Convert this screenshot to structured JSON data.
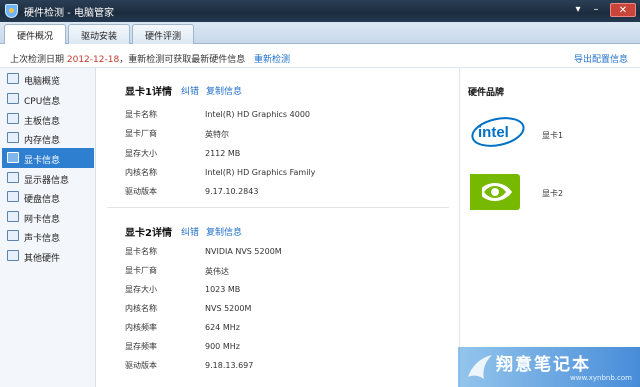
{
  "window": {
    "title": "硬件检测 - 电脑管家"
  },
  "tabs": [
    {
      "label": "硬件概况"
    },
    {
      "label": "驱动安装"
    },
    {
      "label": "硬件评测"
    }
  ],
  "infobar": {
    "prefix": "上次检测日期 ",
    "date": "2012-12-18",
    "suffix": "，重新检测可获取最新硬件信息",
    "recheck_label": "重新检测",
    "export_label": "导出配置信息"
  },
  "sidebar": {
    "items": [
      {
        "label": "电脑概览",
        "icon": "computer-icon"
      },
      {
        "label": "CPU信息",
        "icon": "cpu-icon"
      },
      {
        "label": "主板信息",
        "icon": "motherboard-icon"
      },
      {
        "label": "内存信息",
        "icon": "memory-icon"
      },
      {
        "label": "显卡信息",
        "icon": "graphics-card-icon"
      },
      {
        "label": "显示器信息",
        "icon": "monitor-icon"
      },
      {
        "label": "硬盘信息",
        "icon": "hard-disk-icon"
      },
      {
        "label": "网卡信息",
        "icon": "network-card-icon"
      },
      {
        "label": "声卡信息",
        "icon": "sound-card-icon"
      },
      {
        "label": "其他硬件",
        "icon": "other-hardware-icon"
      }
    ],
    "active_index": 4
  },
  "gpu1": {
    "title": "显卡1详情",
    "correct_label": "纠错",
    "copy_label": "复制信息",
    "rows": [
      {
        "label": "显卡名称",
        "value": "Intel(R) HD Graphics 4000"
      },
      {
        "label": "显卡厂商",
        "value": "英特尔"
      },
      {
        "label": "显存大小",
        "value": "2112 MB"
      },
      {
        "label": "内核名称",
        "value": "Intel(R) HD Graphics Family"
      },
      {
        "label": "驱动版本",
        "value": "9.17.10.2843"
      }
    ]
  },
  "gpu2": {
    "title": "显卡2详情",
    "correct_label": "纠错",
    "copy_label": "复制信息",
    "rows": [
      {
        "label": "显卡名称",
        "value": "NVIDIA NVS 5200M"
      },
      {
        "label": "显卡厂商",
        "value": "英伟达"
      },
      {
        "label": "显存大小",
        "value": "1023 MB"
      },
      {
        "label": "内核名称",
        "value": "NVS 5200M"
      },
      {
        "label": "内核频率",
        "value": "624 MHz"
      },
      {
        "label": "显存频率",
        "value": "900 MHz"
      },
      {
        "label": "驱动版本",
        "value": "9.18.13.697"
      }
    ]
  },
  "brands": {
    "title": "硬件品牌",
    "items": [
      {
        "logo": "intel-logo",
        "logo_text": "intel",
        "label": "显卡1"
      },
      {
        "logo": "nvidia-logo",
        "label": "显卡2"
      }
    ]
  },
  "watermark": {
    "text": "翔意笔记本",
    "url": "www.xynbnb.com"
  },
  "colors": {
    "accent": "#2e7fd0",
    "link": "#1f6fc7",
    "date": "#c0392b",
    "titlebar": "#1c2c3f"
  }
}
